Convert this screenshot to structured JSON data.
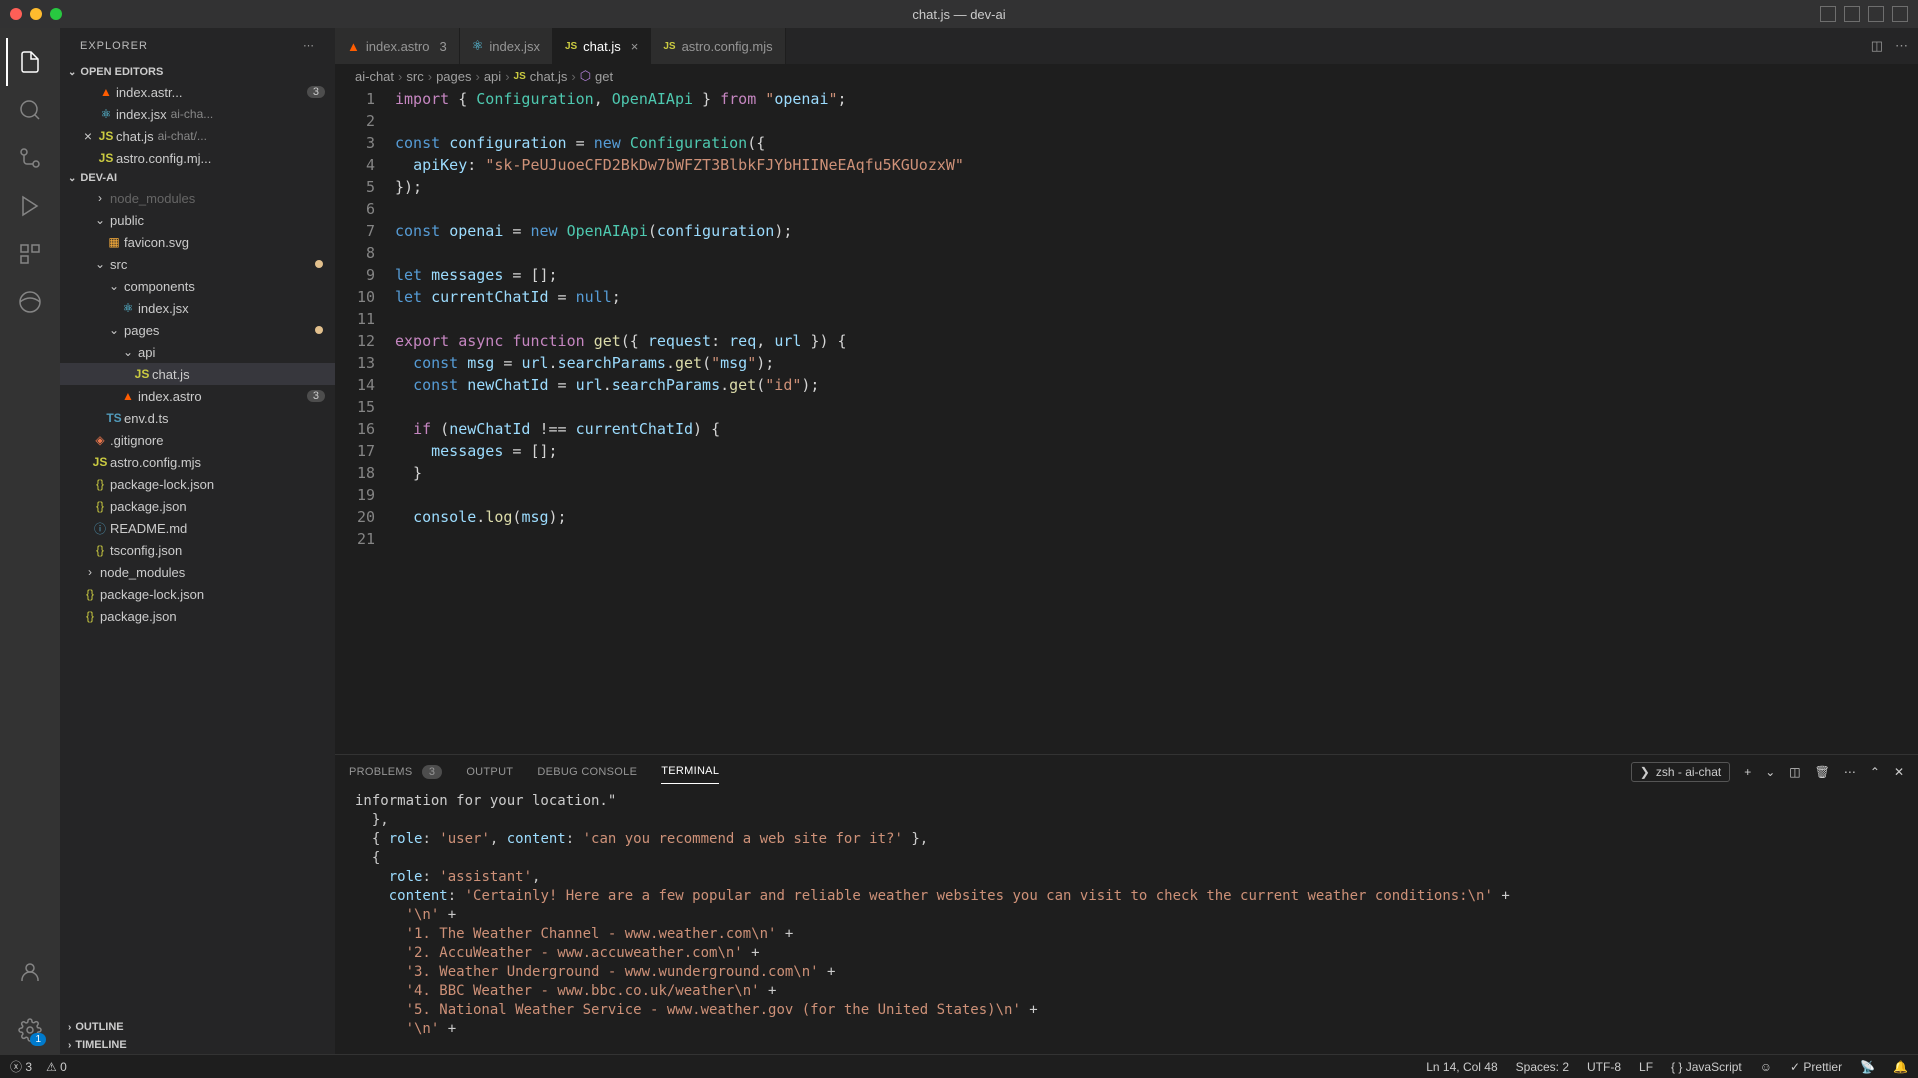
{
  "window": {
    "title": "chat.js — dev-ai"
  },
  "sidebar": {
    "title": "EXPLORER",
    "sections": {
      "openEditors": {
        "label": "OPEN EDITORS",
        "items": [
          {
            "name": "index.astr...",
            "badge": "3",
            "icon": "astro"
          },
          {
            "name": "index.jsx",
            "dim": "ai-cha...",
            "icon": "react"
          },
          {
            "name": "chat.js",
            "dim": "ai-chat/...",
            "icon": "js",
            "close": true
          },
          {
            "name": "astro.config.mj...",
            "icon": "js"
          }
        ]
      },
      "project": {
        "label": "DEV-AI",
        "tree": [
          {
            "name": "node_modules",
            "type": "folder",
            "indent": 1,
            "dim": true,
            "chev": ">"
          },
          {
            "name": "public",
            "type": "folder",
            "indent": 1,
            "chev": "v"
          },
          {
            "name": "favicon.svg",
            "type": "file",
            "indent": 2,
            "icon": "svg"
          },
          {
            "name": "src",
            "type": "folder",
            "indent": 1,
            "chev": "v",
            "dot": true
          },
          {
            "name": "components",
            "type": "folder",
            "indent": 2,
            "chev": "v"
          },
          {
            "name": "index.jsx",
            "type": "file",
            "indent": 3,
            "icon": "react"
          },
          {
            "name": "pages",
            "type": "folder",
            "indent": 2,
            "chev": "v",
            "dot": true
          },
          {
            "name": "api",
            "type": "folder",
            "indent": 3,
            "chev": "v"
          },
          {
            "name": "chat.js",
            "type": "file",
            "indent": 4,
            "icon": "js",
            "active": true
          },
          {
            "name": "index.astro",
            "type": "file",
            "indent": 3,
            "icon": "astro",
            "badge": "3"
          },
          {
            "name": "env.d.ts",
            "type": "file",
            "indent": 2,
            "icon": "ts"
          },
          {
            "name": ".gitignore",
            "type": "file",
            "indent": 1,
            "icon": "git"
          },
          {
            "name": "astro.config.mjs",
            "type": "file",
            "indent": 1,
            "icon": "js"
          },
          {
            "name": "package-lock.json",
            "type": "file",
            "indent": 1,
            "icon": "json"
          },
          {
            "name": "package.json",
            "type": "file",
            "indent": 1,
            "icon": "json"
          },
          {
            "name": "README.md",
            "type": "file",
            "indent": 1,
            "icon": "md"
          },
          {
            "name": "tsconfig.json",
            "type": "file",
            "indent": 1,
            "icon": "json"
          },
          {
            "name": "node_modules",
            "type": "folder",
            "indent": 0,
            "chev": ">"
          },
          {
            "name": "package-lock.json",
            "type": "file",
            "indent": 0,
            "icon": "json"
          },
          {
            "name": "package.json",
            "type": "file",
            "indent": 0,
            "icon": "json"
          }
        ]
      },
      "outline": {
        "label": "OUTLINE"
      },
      "timeline": {
        "label": "TIMELINE"
      }
    }
  },
  "tabs": [
    {
      "label": "index.astro",
      "badge": "3",
      "icon": "astro"
    },
    {
      "label": "index.jsx",
      "icon": "react"
    },
    {
      "label": "chat.js",
      "icon": "js",
      "active": true,
      "close": true
    },
    {
      "label": "astro.config.mjs",
      "icon": "js"
    }
  ],
  "breadcrumb": [
    "ai-chat",
    "src",
    "pages",
    "api",
    "chat.js",
    "get"
  ],
  "code": {
    "lines": [
      "import { Configuration, OpenAIApi } from \"openai\";",
      "",
      "const configuration = new Configuration({",
      "  apiKey: \"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\"",
      "});",
      "",
      "const openai = new OpenAIApi(configuration);",
      "",
      "let messages = [];",
      "let currentChatId = null;",
      "",
      "export async function get({ request: req, url }) {",
      "  const msg = url.searchParams.get(\"msg\");",
      "  const newChatId = url.searchParams.get(\"id\");",
      "",
      "  if (newChatId !== currentChatId) {",
      "    messages = [];",
      "  }",
      "",
      "  console.log(msg);",
      ""
    ]
  },
  "panel": {
    "tabs": {
      "problems": "PROBLEMS",
      "problemsCount": "3",
      "output": "OUTPUT",
      "debug": "DEBUG CONSOLE",
      "terminal": "TERMINAL"
    },
    "terminalLabel": "zsh - ai-chat",
    "terminal": [
      "information for your location.\"",
      "  },",
      "  { role: 'user', content: 'can you recommend a web site for it?' },",
      "  {",
      "    role: 'assistant',",
      "    content: 'Certainly! Here are a few popular and reliable weather websites you can visit to check the current weather conditions:\\n' +",
      "      '\\n' +",
      "      '1. The Weather Channel - www.weather.com\\n' +",
      "      '2. AccuWeather - www.accuweather.com\\n' +",
      "      '3. Weather Underground - www.wunderground.com\\n' +",
      "      '4. BBC Weather - www.bbc.co.uk/weather\\n' +",
      "      '5. National Weather Service - www.weather.gov (for the United States)\\n' +",
      "      '\\n' +"
    ]
  },
  "status": {
    "errors": "3",
    "warnings": "0",
    "position": "Ln 14, Col 48",
    "spaces": "Spaces: 2",
    "encoding": "UTF-8",
    "eol": "LF",
    "lang": "JavaScript",
    "prettier": "Prettier"
  },
  "activityBadge": "1"
}
